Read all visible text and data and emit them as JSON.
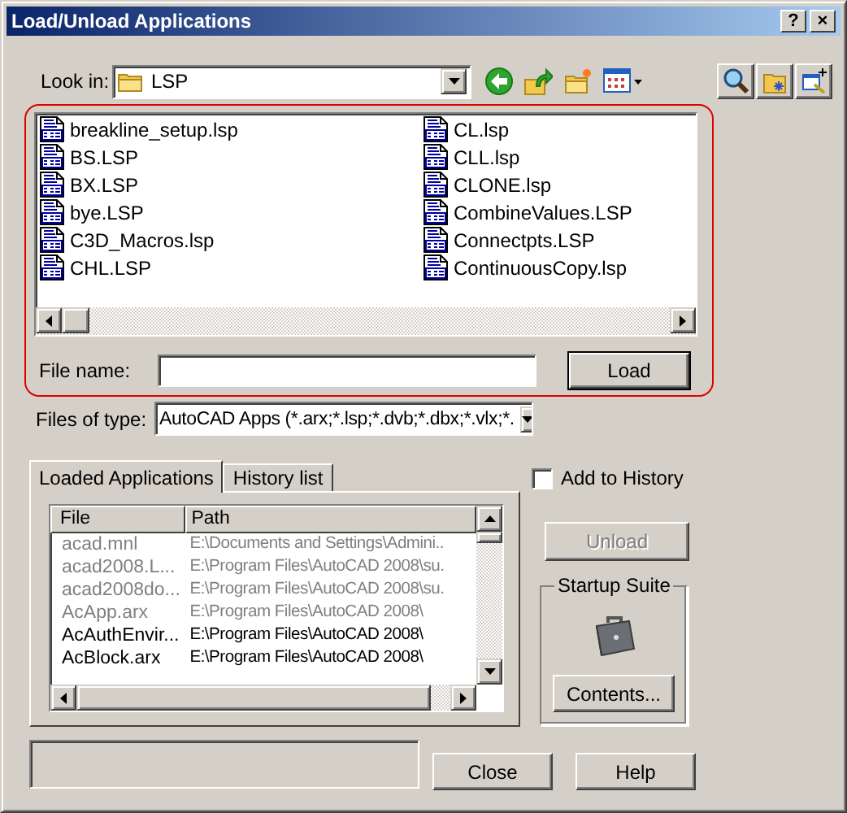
{
  "window": {
    "title": "Load/Unload Applications",
    "title_buttons": [
      "?",
      "×"
    ]
  },
  "look_in": {
    "label": "Look in:",
    "value": "LSP"
  },
  "files": [
    {
      "name": "breakline_setup.lsp"
    },
    {
      "name": "BS.LSP"
    },
    {
      "name": "BX.LSP"
    },
    {
      "name": "bye.LSP"
    },
    {
      "name": "C3D_Macros.lsp"
    },
    {
      "name": "CHL.LSP"
    },
    {
      "name": "CL.lsp"
    },
    {
      "name": "CLL.lsp"
    },
    {
      "name": "CLONE.lsp"
    },
    {
      "name": "CombineValues.LSP"
    },
    {
      "name": "Connectpts.LSP"
    },
    {
      "name": "ContinuousCopy.lsp"
    }
  ],
  "file_name": {
    "label": "File name:"
  },
  "load_button": "Load",
  "files_of_type": {
    "label": "Files of type:",
    "value": "AutoCAD Apps (*.arx;*.lsp;*.dvb;*.dbx;*.vlx;*."
  },
  "tabs": [
    {
      "label": "Loaded Applications",
      "selected": true
    },
    {
      "label": "History list",
      "selected": false
    }
  ],
  "loaded_table": {
    "columns": [
      "File",
      "Path"
    ],
    "rows": [
      {
        "file": "acad.mnl",
        "path": "E:\\Documents and Settings\\Admini..",
        "disabled": true
      },
      {
        "file": "acad2008.L...",
        "path": "E:\\Program Files\\AutoCAD 2008\\su.",
        "disabled": true
      },
      {
        "file": "acad2008do...",
        "path": "E:\\Program Files\\AutoCAD 2008\\su.",
        "disabled": true
      },
      {
        "file": "AcApp.arx",
        "path": "E:\\Program Files\\AutoCAD 2008\\",
        "disabled": true
      },
      {
        "file": "AcAuthEnvir...",
        "path": "E:\\Program Files\\AutoCAD 2008\\",
        "disabled": false
      },
      {
        "file": "AcBlock.arx",
        "path": "E:\\Program Files\\AutoCAD 2008\\",
        "disabled": false
      }
    ]
  },
  "add_to_history": {
    "label": "Add to History",
    "checked": false
  },
  "unload_button": {
    "label": "Unload",
    "disabled": true
  },
  "startup_suite": {
    "title": "Startup Suite",
    "button": "Contents..."
  },
  "buttons": [
    "Close",
    "Help"
  ]
}
